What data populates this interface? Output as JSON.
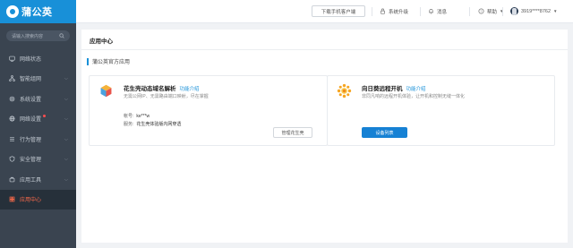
{
  "brand": {
    "name": "蒲公英"
  },
  "sidebar": {
    "search_placeholder": "请输入搜索内容",
    "items": [
      {
        "label": "网络状态",
        "icon": "status-icon",
        "has_chevron": false
      },
      {
        "label": "智能组网",
        "icon": "network-icon",
        "has_chevron": true
      },
      {
        "label": "系统设置",
        "icon": "settings-icon",
        "has_chevron": true
      },
      {
        "label": "网络设置",
        "icon": "globe-icon",
        "has_chevron": true,
        "badge": true
      },
      {
        "label": "行为管理",
        "icon": "behavior-icon",
        "has_chevron": true
      },
      {
        "label": "安全管理",
        "icon": "security-icon",
        "has_chevron": true
      },
      {
        "label": "应用工具",
        "icon": "tools-icon",
        "has_chevron": true
      },
      {
        "label": "应用中心",
        "icon": "app-center-icon",
        "has_chevron": false,
        "active": true
      }
    ]
  },
  "header": {
    "download_label": "下载手机客户端",
    "upgrade_label": "系统升级",
    "message_label": "消息",
    "help_label": "帮助",
    "user_label": "3919****8762"
  },
  "main": {
    "page_title": "应用中心",
    "section_title": "蒲公英官方应用",
    "cards": [
      {
        "title": "花生壳动态域名解析",
        "link": "功能介绍",
        "desc": "无需公网IP、无需路由端口映射，尽在掌握",
        "account_key": "帐号:",
        "account_val": "ke***w",
        "service_key": "服务:",
        "service_val": "花生壳体验版内网穿透",
        "button": "管理花生壳"
      },
      {
        "title": "向日葵远程开机",
        "link": "功能介绍",
        "desc": "非同凡响的远程开机体验，让开机和控制无缝一体化",
        "button": "设备列表"
      }
    ]
  },
  "colors": {
    "brand_blue": "#1890d8",
    "sidebar_bg": "#3a4450",
    "active_text": "#ff6b4a",
    "primary_button": "#1681d4"
  }
}
